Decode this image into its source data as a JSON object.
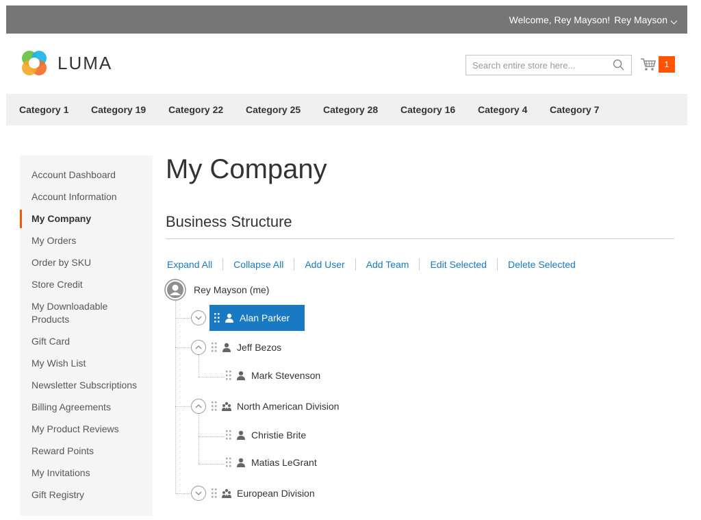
{
  "header": {
    "welcome": "Welcome, Rey Mayson!",
    "user_name": "Rey Mayson",
    "logo_text": "LUMA",
    "search_placeholder": "Search entire store here...",
    "cart_count": "1"
  },
  "categories": [
    "Category 1",
    "Category 19",
    "Category 22",
    "Category 25",
    "Category 28",
    "Category 16",
    "Category 4",
    "Category 7"
  ],
  "sidebar": {
    "items": [
      "Account Dashboard",
      "Account Information",
      "My Company",
      "My Orders",
      "Order by SKU",
      "Store Credit",
      "My Downloadable Products",
      "Gift Card",
      "My Wish List",
      "Newsletter Subscriptions",
      "Billing Agreements",
      "My Product Reviews",
      "Reward Points",
      "My Invitations",
      "Gift Registry"
    ],
    "active": "My Company"
  },
  "main": {
    "title": "My Company",
    "section_title": "Business Structure",
    "actions": [
      "Expand All",
      "Collapse All",
      "Add User",
      "Add Team",
      "Edit Selected",
      "Delete Selected"
    ]
  },
  "tree": {
    "root": "Rey Mayson (me)",
    "nodes": [
      "Alan Parker",
      "Jeff Bezos",
      "Mark Stevenson",
      "North American Division",
      "Christie Brite",
      "Matias LeGrant",
      "European Division"
    ]
  },
  "colors": {
    "topbar": "#767676",
    "accent": "#ff5501",
    "link": "#1979c3",
    "selected": "#1979c3"
  }
}
